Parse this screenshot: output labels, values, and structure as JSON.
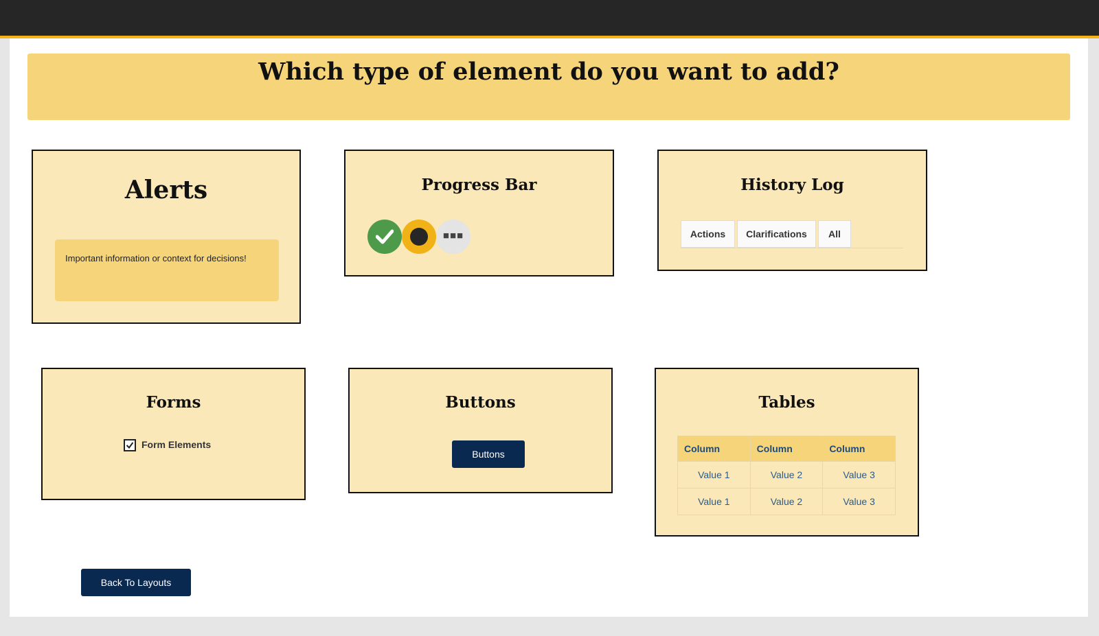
{
  "header": {
    "accent_color": "#f2b319",
    "bar_color": "#262626"
  },
  "banner": {
    "title": "Which type of element do you want to add?"
  },
  "cards": {
    "alerts": {
      "title": "Alerts",
      "alert_text": "Important information or context for decisions!"
    },
    "progress_bar": {
      "title": "Progress Bar",
      "steps": [
        {
          "state": "complete",
          "icon": "check-icon",
          "color": "#4e9a4b"
        },
        {
          "state": "current",
          "icon": "dot-icon",
          "color": "#f0b216"
        },
        {
          "state": "pending",
          "icon": "ellipsis-icon",
          "color": "#e4e4e4"
        }
      ]
    },
    "history_log": {
      "title": "History Log",
      "tabs": [
        "Actions",
        "Clarifications",
        "All"
      ]
    },
    "forms": {
      "title": "Forms",
      "checkbox_label": "Form Elements",
      "checkbox_checked": true
    },
    "buttons": {
      "title": "Buttons",
      "sample_button_label": "Buttons"
    },
    "tables": {
      "title": "Tables",
      "columns": [
        "Column",
        "Column",
        "Column"
      ],
      "rows": [
        [
          "Value 1",
          "Value 2",
          "Value 3"
        ],
        [
          "Value 1",
          "Value 2",
          "Value 3"
        ]
      ]
    }
  },
  "footer": {
    "back_button_label": "Back To Layouts"
  }
}
